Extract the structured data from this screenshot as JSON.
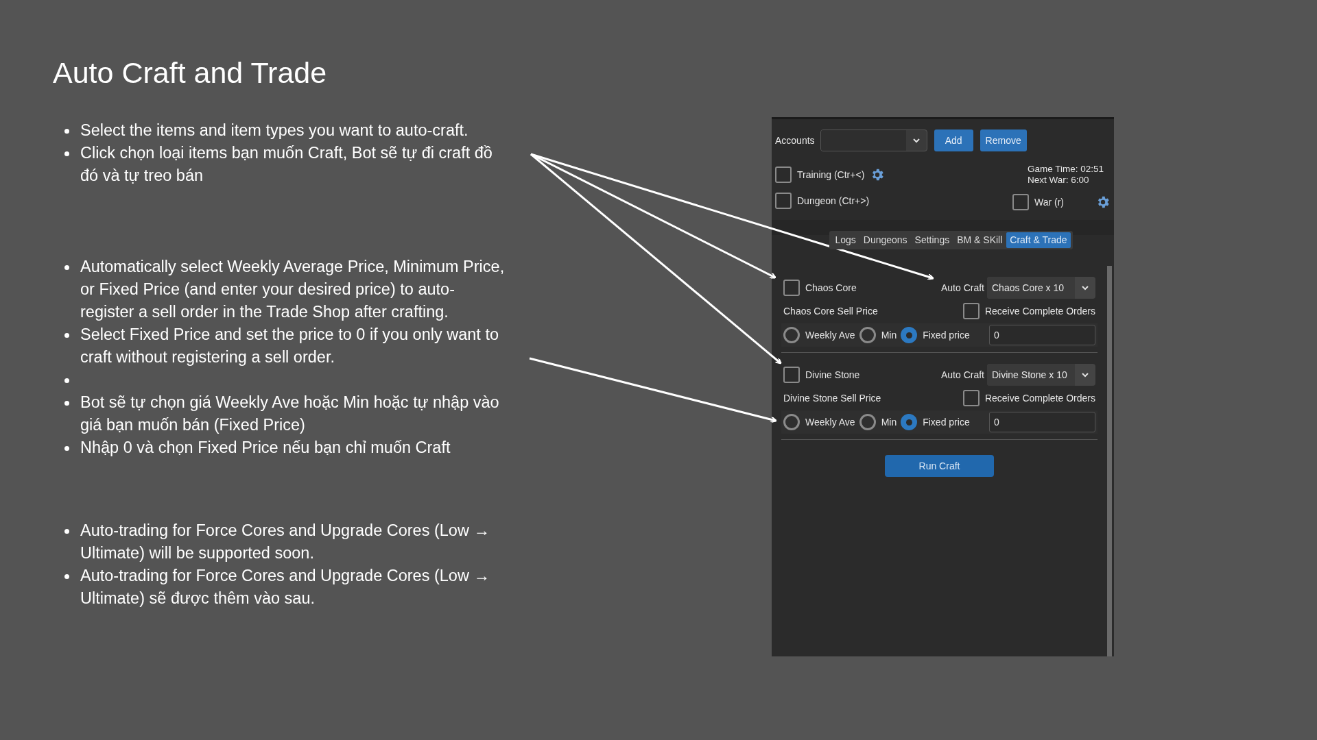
{
  "title": "Auto Craft and Trade",
  "bullet_groups": [
    {
      "items": [
        {
          "kind": "text",
          "text": "Select the items and item types you want to auto-craft."
        },
        {
          "kind": "text",
          "text": "Click chọn loại items bạn muốn Craft, Bot sẽ tự đi craft đồ đó và tự treo bán"
        }
      ]
    },
    {
      "items": [
        {
          "kind": "text",
          "text": "Automatically select Weekly Average Price, Minimum Price, or Fixed Price (and enter your desired price) to auto-register a sell order in the Trade Shop after crafting."
        },
        {
          "kind": "text",
          "text": "Select Fixed Price and set the price to 0 if you only want to craft without registering a sell order."
        },
        {
          "kind": "blank"
        },
        {
          "kind": "text",
          "text": "Bot sẽ tự chọn giá Weekly Ave hoặc Min hoặc tự nhập vào giá bạn muốn bán (Fixed Price)"
        },
        {
          "kind": "text",
          "text": "Nhập 0 và chọn Fixed Price nếu bạn chỉ muốn Craft"
        }
      ]
    },
    {
      "items": [
        {
          "kind": "text",
          "text": "Auto-trading for Force Cores and Upgrade Cores (Low → Ultimate) will be supported soon."
        },
        {
          "kind": "text",
          "text": "Auto-trading for Force Cores and Upgrade Cores (Low → Ultimate)  sẽ được thêm vào sau."
        }
      ]
    }
  ],
  "app": {
    "accounts_label": "Accounts",
    "add_button": "Add",
    "remove_button": "Remove",
    "training": {
      "label": "Training (Ctr+<)",
      "checked": false
    },
    "dungeon": {
      "label": "Dungeon (Ctr+>)",
      "checked": false
    },
    "war": {
      "label": "War (r)",
      "checked": false
    },
    "game_time": "Game Time: 02:51",
    "next_war": "Next War: 6:00",
    "tabs": [
      {
        "label": "Logs",
        "selected": false
      },
      {
        "label": "Dungeons",
        "selected": false
      },
      {
        "label": "Settings",
        "selected": false
      },
      {
        "label": "BM & SKill",
        "selected": false
      },
      {
        "label": "Craft & Trade",
        "selected": true
      }
    ],
    "items": [
      {
        "name": "Chaos Core",
        "checked": false,
        "auto_craft_label": "Auto Craft",
        "auto_craft_value": "Chaos Core x 10",
        "sell_price_label": "Chaos Core Sell Price",
        "receive": {
          "label": "Receive Complete Orders",
          "checked": false
        },
        "options": [
          {
            "label": "Weekly Ave",
            "selected": false
          },
          {
            "label": "Min",
            "selected": false
          },
          {
            "label": "Fixed price",
            "selected": true
          }
        ],
        "price": "0"
      },
      {
        "name": "Divine Stone",
        "checked": false,
        "auto_craft_label": "Auto Craft",
        "auto_craft_value": "Divine Stone x 10",
        "sell_price_label": "Divine Stone Sell Price",
        "receive": {
          "label": "Receive Complete Orders",
          "checked": false
        },
        "options": [
          {
            "label": "Weekly Ave",
            "selected": false
          },
          {
            "label": "Min",
            "selected": false
          },
          {
            "label": "Fixed price",
            "selected": true
          }
        ],
        "price": "0"
      }
    ],
    "run_button": "Run Craft"
  }
}
